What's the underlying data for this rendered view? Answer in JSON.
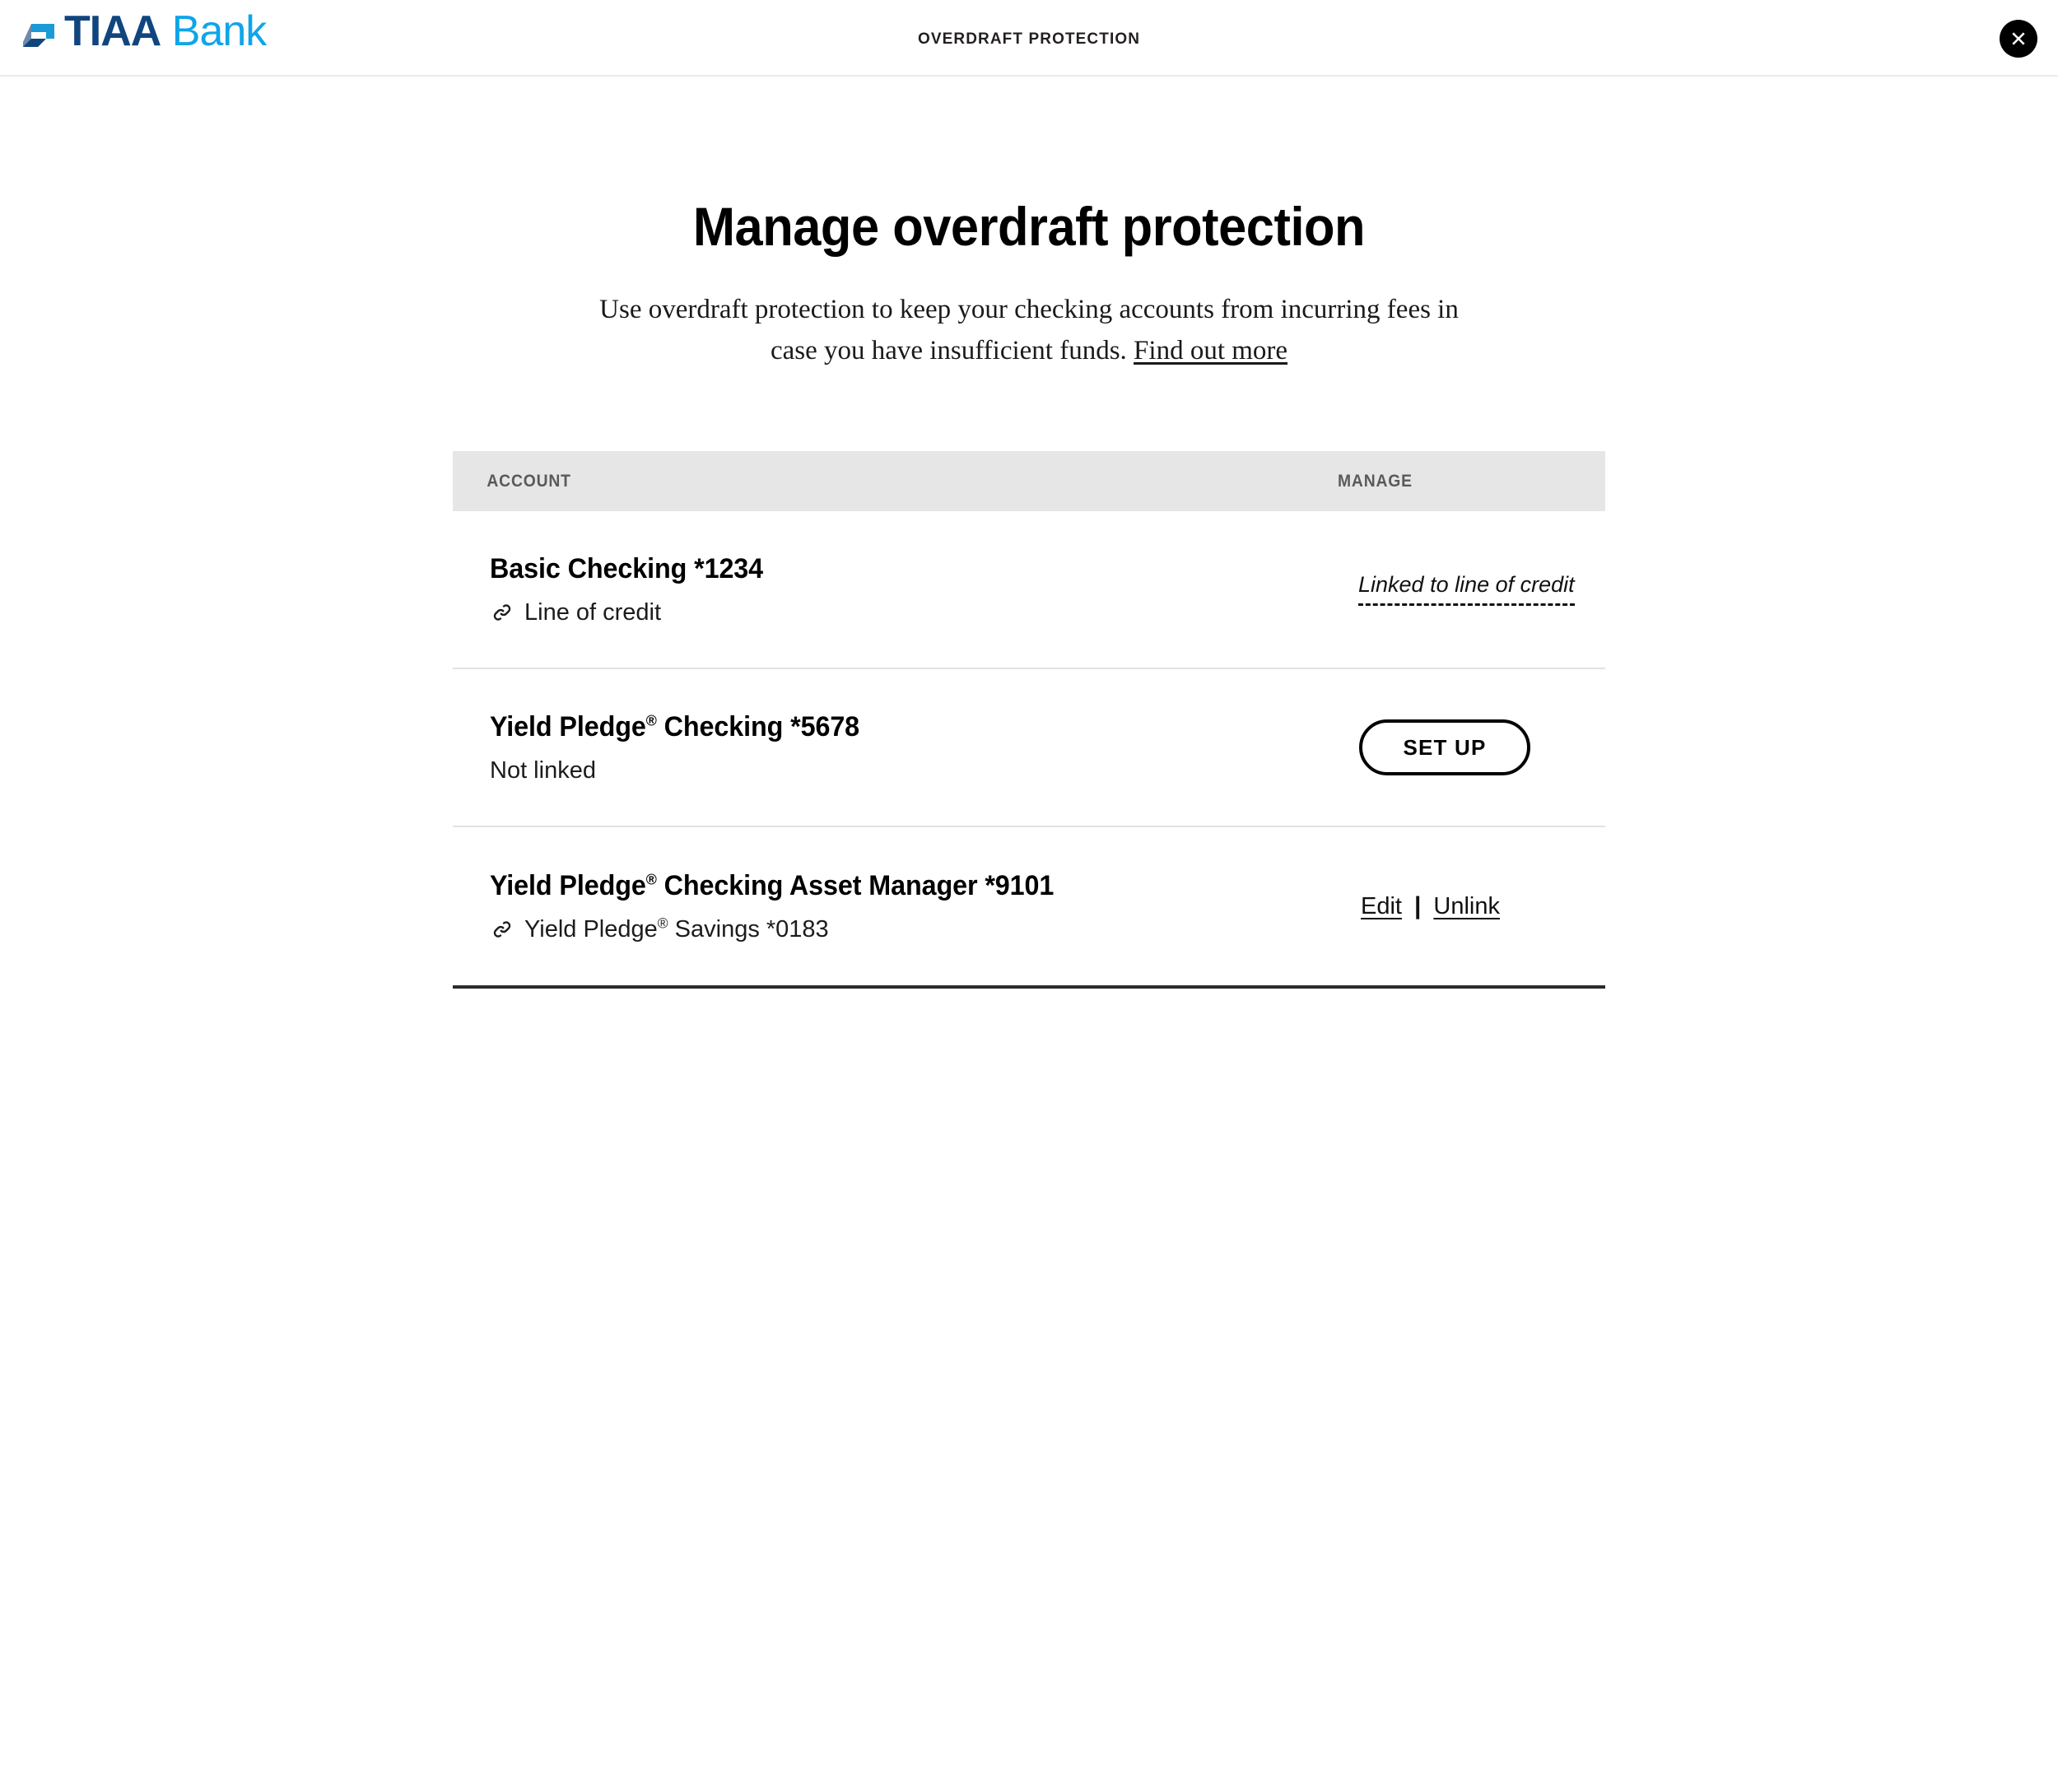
{
  "topbar": {
    "logo": {
      "mark_name": "tiaa-bank-logo-mark",
      "primary_text": "TIAA",
      "secondary_text": " Bank",
      "primary_color": "#11457e",
      "secondary_color": "#0ea5e9"
    },
    "title": "OVERDRAFT PROTECTION",
    "close_label": "close-icon"
  },
  "hero": {
    "title": "Manage overdraft protection",
    "subtitle_text": "Use overdraft protection to keep your checking accounts from incurring fees in case you have insufficient funds. ",
    "subtitle_link": "Find out more"
  },
  "table": {
    "columns": {
      "account": "ACCOUNT",
      "manage": "MANAGE"
    },
    "rows": [
      {
        "name": "Basic Checking *1234",
        "name_pre": "Basic Checking *1234",
        "name_sup": "",
        "name_post": "",
        "sub_pre": "Line of credit",
        "sub_sup": "",
        "sub_post": "",
        "has_link_icon": true,
        "manage_type": "status",
        "status": "Linked to line of credit"
      },
      {
        "name": "Yield Pledge® Checking *5678",
        "name_pre": "Yield Pledge",
        "name_sup": "®",
        "name_post": " Checking *5678",
        "sub_pre": "Not linked",
        "sub_sup": "",
        "sub_post": "",
        "has_link_icon": false,
        "manage_type": "button",
        "button_label": "SET UP"
      },
      {
        "name": "Yield Pledge® Checking Asset Manager *9101",
        "name_pre": "Yield Pledge",
        "name_sup": "®",
        "name_post": " Checking Asset Manager *9101",
        "sub_pre": "Yield Pledge",
        "sub_sup": "®",
        "sub_post": " Savings *0183",
        "has_link_icon": true,
        "manage_type": "links",
        "edit_label": "Edit",
        "separator": "|",
        "unlink_label": "Unlink"
      }
    ]
  },
  "colors": {
    "header_bg": "#e6e6e6",
    "divider": "#e2e2e2",
    "table_bottom": "#2b2b2b",
    "accent_blue": "#0ea5e9",
    "brand_navy": "#11457e"
  }
}
